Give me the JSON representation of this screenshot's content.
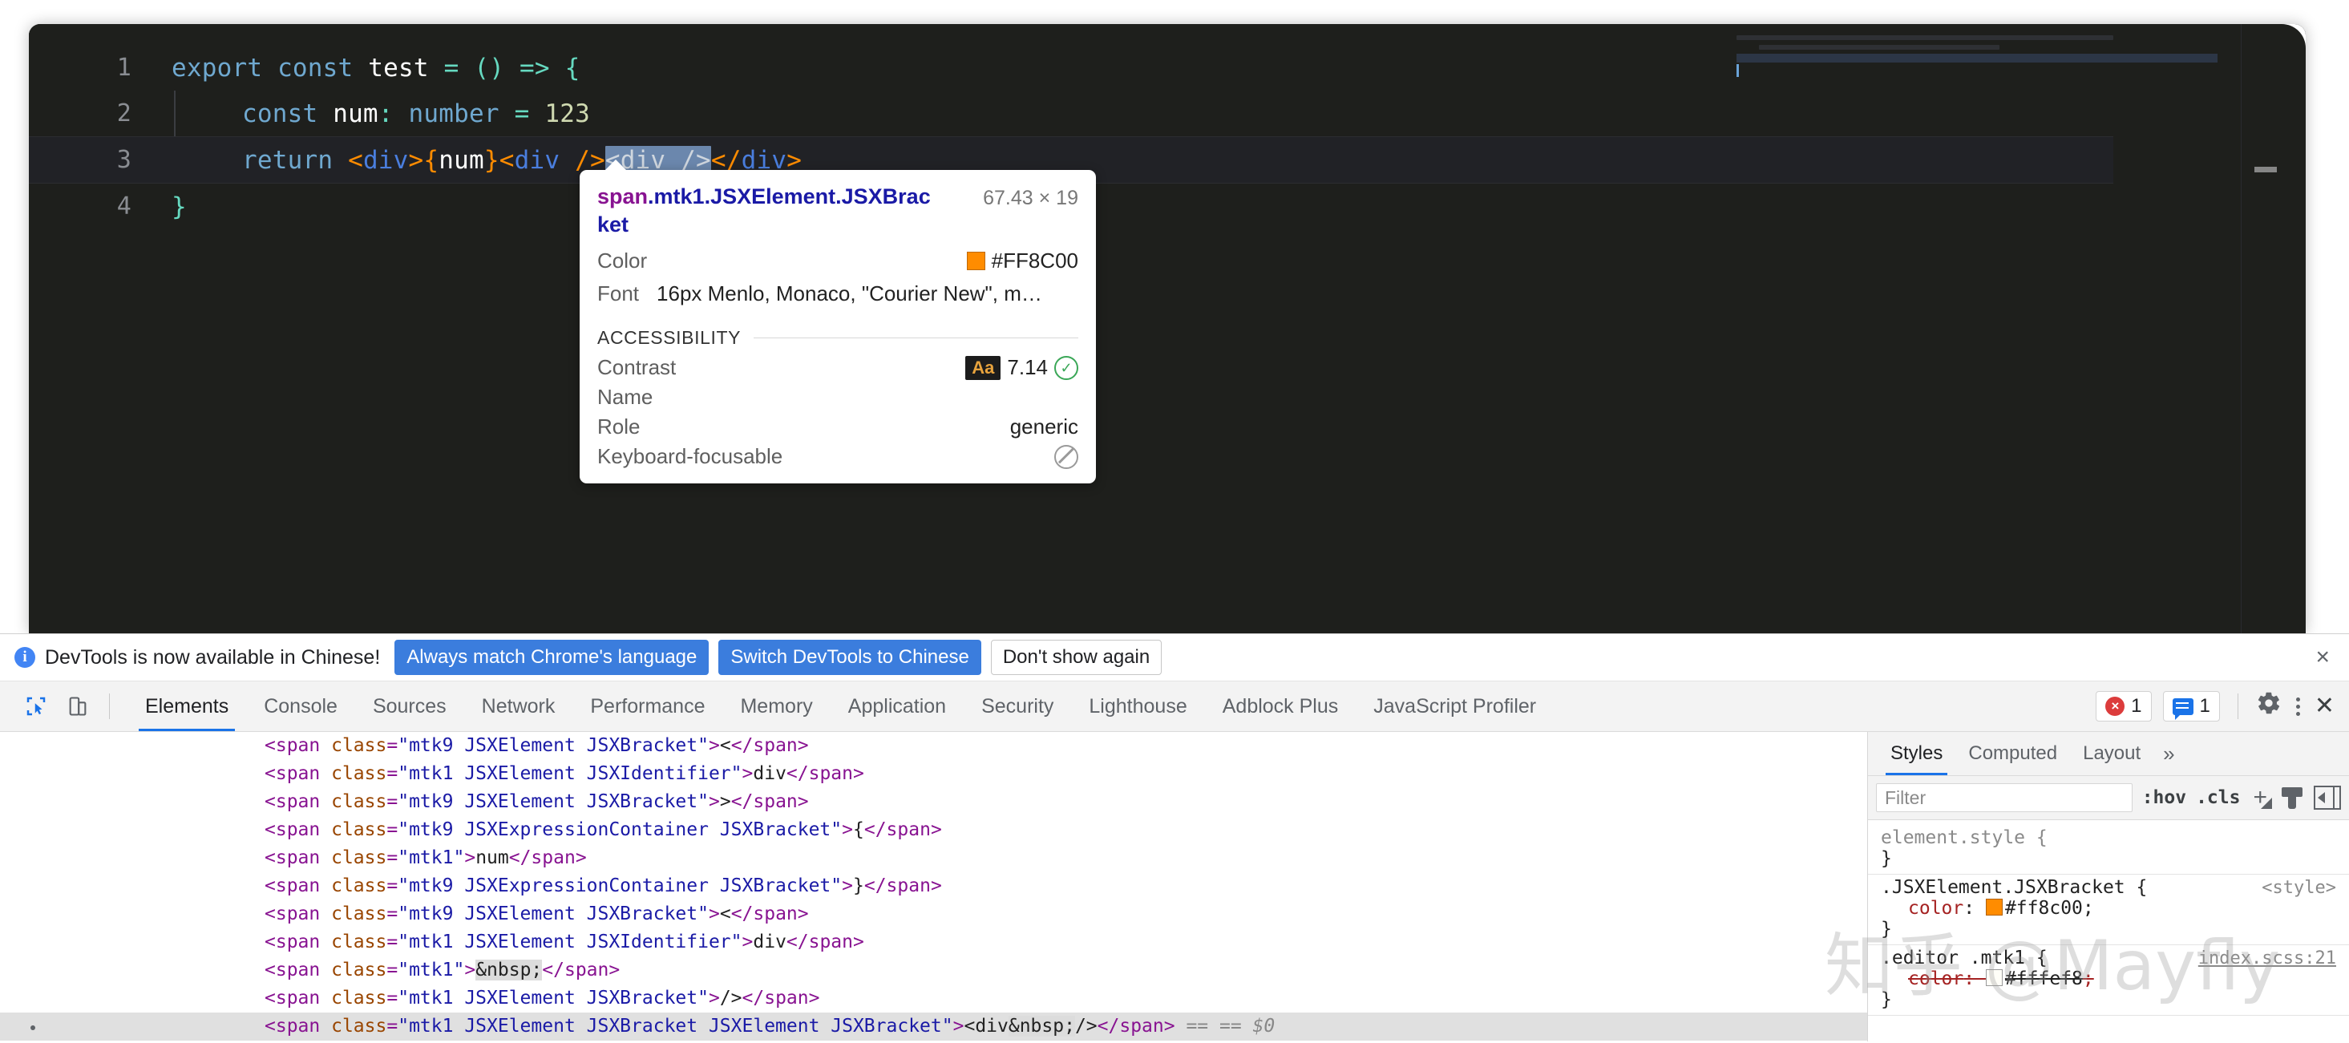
{
  "editor": {
    "lines": [
      {
        "n": "1",
        "active": false
      },
      {
        "n": "2",
        "active": false
      },
      {
        "n": "3",
        "active": true
      },
      {
        "n": "4",
        "active": false
      }
    ],
    "code": {
      "l1": {
        "kw1": "export",
        "kw2": "const",
        "name": "test",
        "eq": "=",
        "parens": "()",
        "arrow": "=>",
        "brace": "{"
      },
      "l2": {
        "kw": "const",
        "name": "num",
        "colon": ":",
        "type": "number",
        "eq": "=",
        "num": "123"
      },
      "l3": {
        "kw": "return",
        "open_lt": "<",
        "tag1": "div",
        "gt": ">",
        "lbrace": "{",
        "expr": "num",
        "rbrace": "}",
        "open_lt2": "<",
        "tag2": "div",
        "selfclose": " />",
        "sel_lt": "<",
        "sel_tag": "div",
        "sel_close": " />",
        "close_lt": "</",
        "tag3": "div",
        "close_gt": ">"
      },
      "l4": {
        "brace": "}"
      }
    }
  },
  "tooltip": {
    "selector_tag": "span",
    "selector_classes": ".mtk1.JSXElement.JSXBracket",
    "dimensions": "67.43 × 19",
    "color_label": "Color",
    "color_value": "#FF8C00",
    "color_swatch": "#FF8C00",
    "font_label": "Font",
    "font_value": "16px Menlo, Monaco, \"Courier New\", m…",
    "a11y_title": "ACCESSIBILITY",
    "contrast_label": "Contrast",
    "contrast_badge": "Aa",
    "contrast_value": "7.14",
    "name_label": "Name",
    "name_value": "",
    "role_label": "Role",
    "role_value": "generic",
    "focusable_label": "Keyboard-focusable"
  },
  "notification": {
    "message": "DevTools is now available in Chinese!",
    "btn_always": "Always match Chrome's language",
    "btn_switch": "Switch DevTools to Chinese",
    "btn_dismiss": "Don't show again",
    "close": "×"
  },
  "tabs": [
    {
      "label": "Elements",
      "active": true
    },
    {
      "label": "Console",
      "active": false
    },
    {
      "label": "Sources",
      "active": false
    },
    {
      "label": "Network",
      "active": false
    },
    {
      "label": "Performance",
      "active": false
    },
    {
      "label": "Memory",
      "active": false
    },
    {
      "label": "Application",
      "active": false
    },
    {
      "label": "Security",
      "active": false
    },
    {
      "label": "Lighthouse",
      "active": false
    },
    {
      "label": "Adblock Plus",
      "active": false
    },
    {
      "label": "JavaScript Profiler",
      "active": false
    }
  ],
  "toolbar_right": {
    "error_count": "1",
    "message_count": "1"
  },
  "dom_lines": [
    {
      "attr": "mtk9 JSXElement JSXBracket",
      "text": "<",
      "selected": false
    },
    {
      "attr": "mtk1 JSXElement JSXIdentifier",
      "text": "div",
      "selected": false
    },
    {
      "attr": "mtk9 JSXElement JSXBracket",
      "text": ">",
      "selected": false
    },
    {
      "attr": "mtk9 JSXExpressionContainer JSXBracket",
      "text": "{",
      "selected": false
    },
    {
      "attr": "mtk1",
      "text": "num",
      "selected": false
    },
    {
      "attr": "mtk9 JSXExpressionContainer JSXBracket",
      "text": "}",
      "selected": false
    },
    {
      "attr": "mtk9 JSXElement JSXBracket",
      "text": "<",
      "selected": false
    },
    {
      "attr": "mtk1 JSXElement JSXIdentifier",
      "text": "div",
      "selected": false
    },
    {
      "attr": "mtk1",
      "text": "&nbsp;",
      "nbsp": true,
      "selected": false
    },
    {
      "attr": "mtk1 JSXElement JSXBracket",
      "text": "/>",
      "selected": false
    },
    {
      "attr": "mtk1 JSXElement JSXBracket JSXElement JSXBracket",
      "text": "<div&nbsp;/>",
      "nbsp": true,
      "selected": true,
      "suffix": "== $0"
    }
  ],
  "styles_panel": {
    "tabs": [
      {
        "label": "Styles",
        "active": true
      },
      {
        "label": "Computed",
        "active": false
      },
      {
        "label": "Layout",
        "active": false
      }
    ],
    "more": "»",
    "filter_placeholder": "Filter",
    "hov": ":hov",
    "cls": ".cls",
    "rules": [
      {
        "selector": "element.style {",
        "close": "}",
        "source": "",
        "muted": true,
        "props": []
      },
      {
        "selector": ".JSXElement.JSXBracket {",
        "close": "}",
        "source": "<style>",
        "source_link": false,
        "muted": false,
        "props": [
          {
            "name": "color",
            "value": "#ff8c00",
            "swatch": "#ff8c00",
            "strike": false
          }
        ]
      },
      {
        "selector": ".editor .mtk1 {",
        "close": "}",
        "source": "index.scss:21",
        "source_link": true,
        "muted": false,
        "props": [
          {
            "name": "color",
            "value": "#fffef8",
            "swatch": "#fffef8",
            "strike": true
          }
        ]
      }
    ]
  },
  "watermark": {
    "text": "知乎 @Mayfly"
  }
}
